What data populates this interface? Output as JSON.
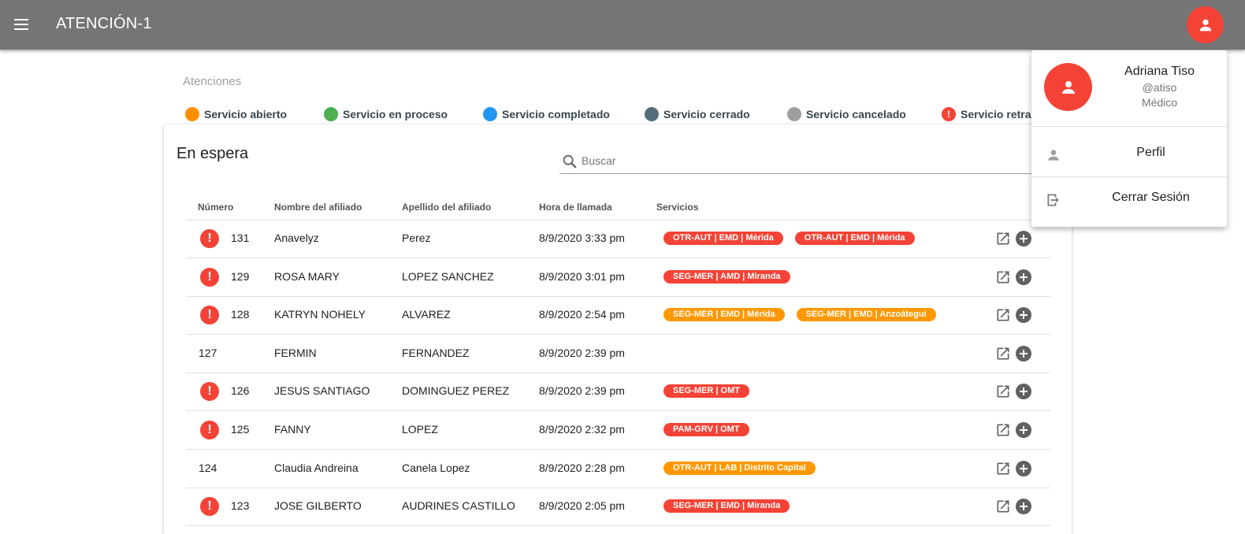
{
  "app": {
    "title": "ATENCIÓN-1"
  },
  "header": {
    "menu_icon": "menu-icon",
    "account_icon": "person-icon"
  },
  "page": {
    "heading": "Atenciones"
  },
  "legend": [
    {
      "label": "Servicio abierto",
      "color": "#ff8f00"
    },
    {
      "label": "Servicio en proceso",
      "color": "#4caf50"
    },
    {
      "label": "Servicio completado",
      "color": "#2196f3"
    },
    {
      "label": "Servicio cerrado",
      "color": "#546e7a"
    },
    {
      "label": "Servicio cancelado",
      "color": "#9e9e9e"
    },
    {
      "label": "Servicio retrasado",
      "color": "#f44336",
      "icon": "alert-icon"
    }
  ],
  "card": {
    "title": "En espera",
    "search": {
      "placeholder": "Buscar",
      "value": ""
    },
    "columns": [
      "Número",
      "Nombre del afiliado",
      "Apellido del afiliado",
      "Hora de llamada",
      "Servicios"
    ],
    "rows": [
      {
        "alert": true,
        "numero": "131",
        "nombre": "Anavelyz",
        "apellido": "Perez",
        "hora": "8/9/2020 3:33 pm",
        "servicios": [
          {
            "label": "OTR-AUT | EMD | Mérida",
            "color": "red"
          },
          {
            "label": "OTR-AUT | EMD | Mérida",
            "color": "red"
          }
        ]
      },
      {
        "alert": true,
        "numero": "129",
        "nombre": "ROSA MARY",
        "apellido": "LOPEZ SANCHEZ",
        "hora": "8/9/2020 3:01 pm",
        "servicios": [
          {
            "label": "SEG-MER | AMD | Miranda",
            "color": "red"
          }
        ]
      },
      {
        "alert": true,
        "numero": "128",
        "nombre": "KATRYN NOHELY",
        "apellido": "ALVAREZ",
        "hora": "8/9/2020 2:54 pm",
        "servicios": [
          {
            "label": "SEG-MER | EMD | Mérida",
            "color": "orange"
          },
          {
            "label": "SEG-MER | EMD | Anzoátegui",
            "color": "orange"
          }
        ]
      },
      {
        "alert": false,
        "numero": "127",
        "nombre": "FERMIN",
        "apellido": "FERNANDEZ",
        "hora": "8/9/2020 2:39 pm",
        "servicios": []
      },
      {
        "alert": true,
        "numero": "126",
        "nombre": "JESUS SANTIAGO",
        "apellido": "DOMINGUEZ PEREZ",
        "hora": "8/9/2020 2:39 pm",
        "servicios": [
          {
            "label": "SEG-MER | OMT",
            "color": "red"
          }
        ]
      },
      {
        "alert": true,
        "numero": "125",
        "nombre": "FANNY",
        "apellido": "LOPEZ",
        "hora": "8/9/2020 2:32 pm",
        "servicios": [
          {
            "label": "PAM-GRV | OMT",
            "color": "red"
          }
        ]
      },
      {
        "alert": false,
        "numero": "124",
        "nombre": "Claudia Andreina",
        "apellido": "Canela Lopez",
        "hora": "8/9/2020 2:28 pm",
        "servicios": [
          {
            "label": "OTR-AUT | LAB | Distrito Capital",
            "color": "orange"
          }
        ]
      },
      {
        "alert": true,
        "numero": "123",
        "nombre": "JOSE GILBERTO",
        "apellido": "AUDRINES CASTILLO",
        "hora": "8/9/2020 2:05 pm",
        "servicios": [
          {
            "label": "SEG-MER | EMD | Miranda",
            "color": "red"
          }
        ]
      }
    ],
    "row_actions": {
      "open_icon": "open-in-new-icon",
      "add_icon": "add-circle-icon"
    }
  },
  "user_menu": {
    "name": "Adriana Tiso",
    "username": "@atiso",
    "role": "Médico",
    "items": [
      {
        "label": "Perfil",
        "icon": "person-icon"
      },
      {
        "label": "Cerrar Sesión",
        "icon": "logout-icon"
      }
    ]
  }
}
